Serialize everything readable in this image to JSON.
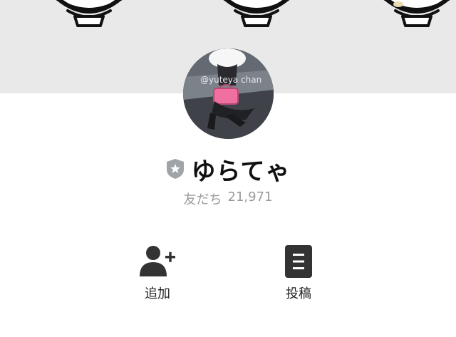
{
  "profile": {
    "display_name": "ゆらてゃ",
    "friends_label": "友だち",
    "friends_count": "21,971",
    "badge_icon": "shield-star-icon",
    "avatar_watermark": "@yuteya chan"
  },
  "actions": [
    {
      "label": "追加",
      "icon": "add-friend-icon"
    },
    {
      "label": "投稿",
      "icon": "post-icon"
    }
  ],
  "colors": {
    "cover_bg": "#e9e9e9",
    "badge_gray": "#9fa4a8",
    "icon_dark": "#333333",
    "pink_bag": "#ee6fa0"
  }
}
